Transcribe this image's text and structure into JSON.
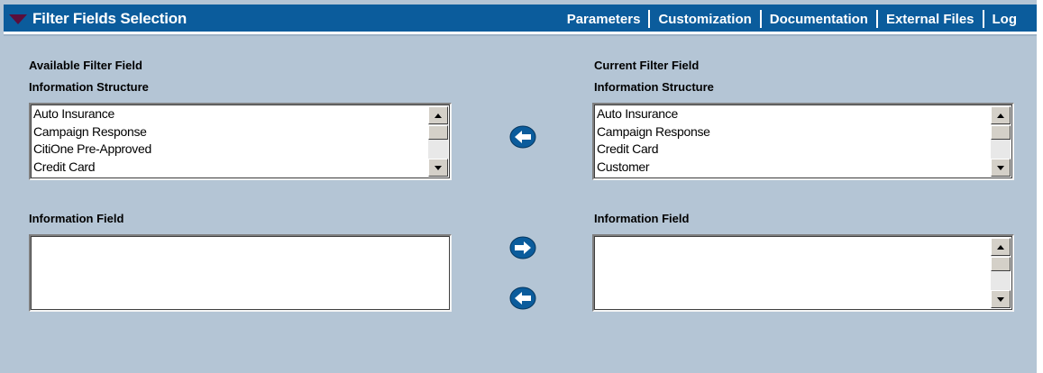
{
  "header": {
    "title": "Filter Fields Selection",
    "nav": [
      "Parameters",
      "Customization",
      "Documentation",
      "External Files",
      "Log"
    ]
  },
  "available": {
    "heading": "Available Filter Field",
    "structure_label": "Information Structure",
    "structure_items": [
      "Auto Insurance",
      "Campaign Response",
      "CitiOne Pre-Approved",
      "Credit Card"
    ],
    "field_label": "Information Field"
  },
  "current": {
    "heading": "Current Filter Field",
    "structure_label": "Information Structure",
    "structure_items": [
      "Auto Insurance",
      "Campaign Response",
      "Credit Card",
      "Customer"
    ],
    "field_label": "Information Field"
  },
  "colors": {
    "panel_bg": "#b4c5d5",
    "titlebar": "#0b5c9c",
    "arrow_button": "#0b5c9c"
  },
  "icons": {
    "remove_structure": "arrow-left-icon",
    "add_field": "arrow-right-icon",
    "remove_field": "arrow-left-icon"
  }
}
